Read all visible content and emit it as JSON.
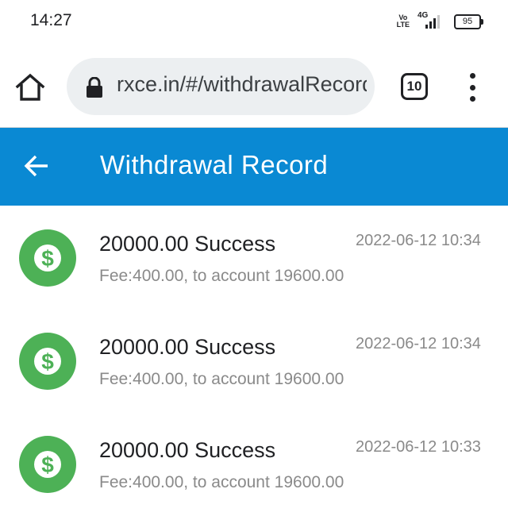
{
  "status_bar": {
    "time": "14:27",
    "volte_top": "Vo",
    "volte_bottom": "LTE",
    "network": "4G",
    "battery": "95"
  },
  "browser": {
    "url": "rxce.in/#/withdrawalRecord",
    "tab_count": "10"
  },
  "header": {
    "title": "Withdrawal Record"
  },
  "records": [
    {
      "amount_status": "20000.00 Success",
      "fee_line": "Fee:400.00, to account 19600.00",
      "time": "2022-06-12 10:34"
    },
    {
      "amount_status": "20000.00 Success",
      "fee_line": "Fee:400.00, to account 19600.00",
      "time": "2022-06-12 10:34"
    },
    {
      "amount_status": "20000.00 Success",
      "fee_line": "Fee:400.00, to account 19600.00",
      "time": "2022-06-12 10:33"
    }
  ],
  "colors": {
    "header_bg": "#0a89d3",
    "success_green": "#4db156"
  }
}
